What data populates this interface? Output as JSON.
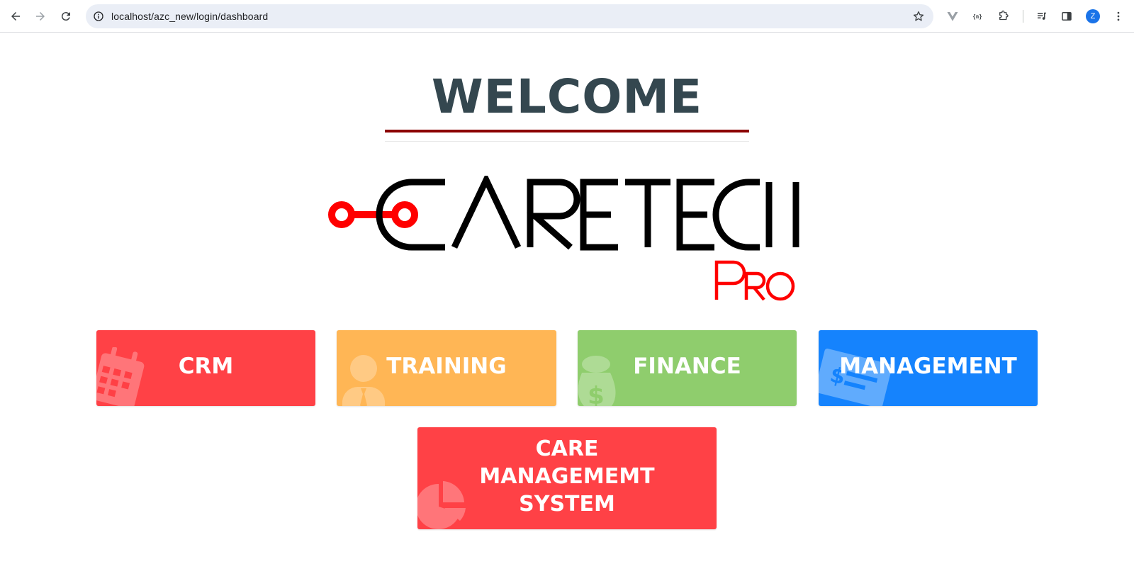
{
  "browser": {
    "url": "localhost/azc_new/login/dashboard",
    "profile_initial": "Z",
    "icons": {
      "back": "back-arrow-icon",
      "forward": "forward-arrow-icon",
      "reload": "reload-icon",
      "site_info": "info-icon",
      "bookmark": "star-icon",
      "extension_1": "vue-extension-icon",
      "extension_2": "json-extension-icon",
      "extensions": "puzzle-icon",
      "media": "media-control-icon",
      "side_panel": "side-panel-icon",
      "menu": "kebab-menu-icon"
    }
  },
  "page": {
    "heading": "WELCOME",
    "logo": {
      "brand": "CARETECH",
      "suffix": "Pro"
    },
    "tiles": [
      {
        "id": "crm",
        "label": "CRM",
        "color": "#ff4146",
        "icon": "calendar-icon"
      },
      {
        "id": "training",
        "label": "TRAINING",
        "color": "#ffb655",
        "icon": "user-tie-icon"
      },
      {
        "id": "finance",
        "label": "FINANCE",
        "color": "#8fcd6d",
        "icon": "money-bag-icon"
      },
      {
        "id": "management",
        "label": "MANAGEMENT",
        "color": "#1583fd",
        "icon": "money-check-icon"
      },
      {
        "id": "care",
        "label": "CARE MANAGEMEMT SYSTEM",
        "color": "#ff4146",
        "icon": "pie-chart-icon"
      }
    ],
    "colors": {
      "heading": "#34474f",
      "heading_rule": "#8b0000",
      "logo_accent": "#ff0000"
    }
  }
}
